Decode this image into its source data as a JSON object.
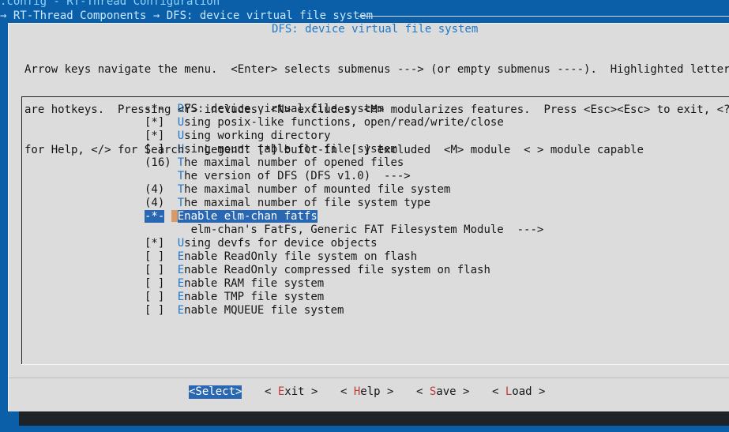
{
  "window": {
    "title": ".config - RT-Thread Configuration",
    "breadcrumb": "→ RT-Thread Components → DFS: device virtual file system"
  },
  "dialog": {
    "title": "DFS: device virtual file system",
    "instructions": [
      "Arrow keys navigate the menu.  <Enter> selects submenus ---> (or empty submenus ----).  Highlighted letters",
      "are hotkeys.  Pressing <Y> includes, <N> excludes, <M> modularizes features.  Press <Esc><Esc> to exit, <?>",
      "for Help, </> for Search.  Legend: [*] built-in  [ ] excluded  <M> module  < > module capable"
    ]
  },
  "menu": {
    "items": [
      {
        "prefix": "-*-",
        "hotkey": "D",
        "text": "FS: device virtual file system",
        "selected": false
      },
      {
        "prefix": "[*]",
        "hotkey": "U",
        "text": "sing posix-like functions, open/read/write/close",
        "selected": false
      },
      {
        "prefix": "[*]",
        "hotkey": "U",
        "text": "sing working directory",
        "selected": false
      },
      {
        "prefix": "[ ]",
        "hotkey": "U",
        "text": "sing mount table for file system",
        "selected": false
      },
      {
        "prefix": "(16)",
        "hotkey": "T",
        "text": "he maximal number of opened files",
        "selected": false
      },
      {
        "prefix": "",
        "hotkey": "T",
        "text": "he version of DFS (DFS v1.0)  --->",
        "selected": false
      },
      {
        "prefix": "(4)",
        "hotkey": "T",
        "text": "he maximal number of mounted file system",
        "selected": false
      },
      {
        "prefix": "(4)",
        "hotkey": "T",
        "text": "he maximal number of file system type",
        "selected": false
      },
      {
        "prefix": "-*-",
        "hotkey": "E",
        "text": "nable elm-chan fatfs",
        "selected": true
      },
      {
        "prefix": "",
        "hotkey": "",
        "text": "elm-chan's FatFs, Generic FAT Filesystem Module  --->",
        "selected": false,
        "indent": 2
      },
      {
        "prefix": "[*]",
        "hotkey": "U",
        "text": "sing devfs for device objects",
        "selected": false
      },
      {
        "prefix": "[ ]",
        "hotkey": "E",
        "text": "nable ReadOnly file system on flash",
        "selected": false
      },
      {
        "prefix": "[ ]",
        "hotkey": "E",
        "text": "nable ReadOnly compressed file system on flash",
        "selected": false
      },
      {
        "prefix": "[ ]",
        "hotkey": "E",
        "text": "nable RAM file system",
        "selected": false
      },
      {
        "prefix": "[ ]",
        "hotkey": "E",
        "text": "nable TMP file system",
        "selected": false
      },
      {
        "prefix": "[ ]",
        "hotkey": "E",
        "text": "nable MQUEUE file system",
        "selected": false
      }
    ]
  },
  "buttons": {
    "select": "<Select>",
    "exit": {
      "left": "< ",
      "hotkey": "E",
      "rest": "xit >"
    },
    "help": {
      "left": "< ",
      "hotkey": "H",
      "rest": "elp >"
    },
    "save": {
      "left": "< ",
      "hotkey": "S",
      "rest": "ave >"
    },
    "load": {
      "left": "< ",
      "hotkey": "L",
      "rest": "oad >"
    }
  },
  "colors": {
    "background": "#0a5fa8",
    "dialog": "#dcdcdc",
    "hotkey": "#1d78c7",
    "button_hotkey": "#c33b3b",
    "highlight": "#2a67b2"
  }
}
